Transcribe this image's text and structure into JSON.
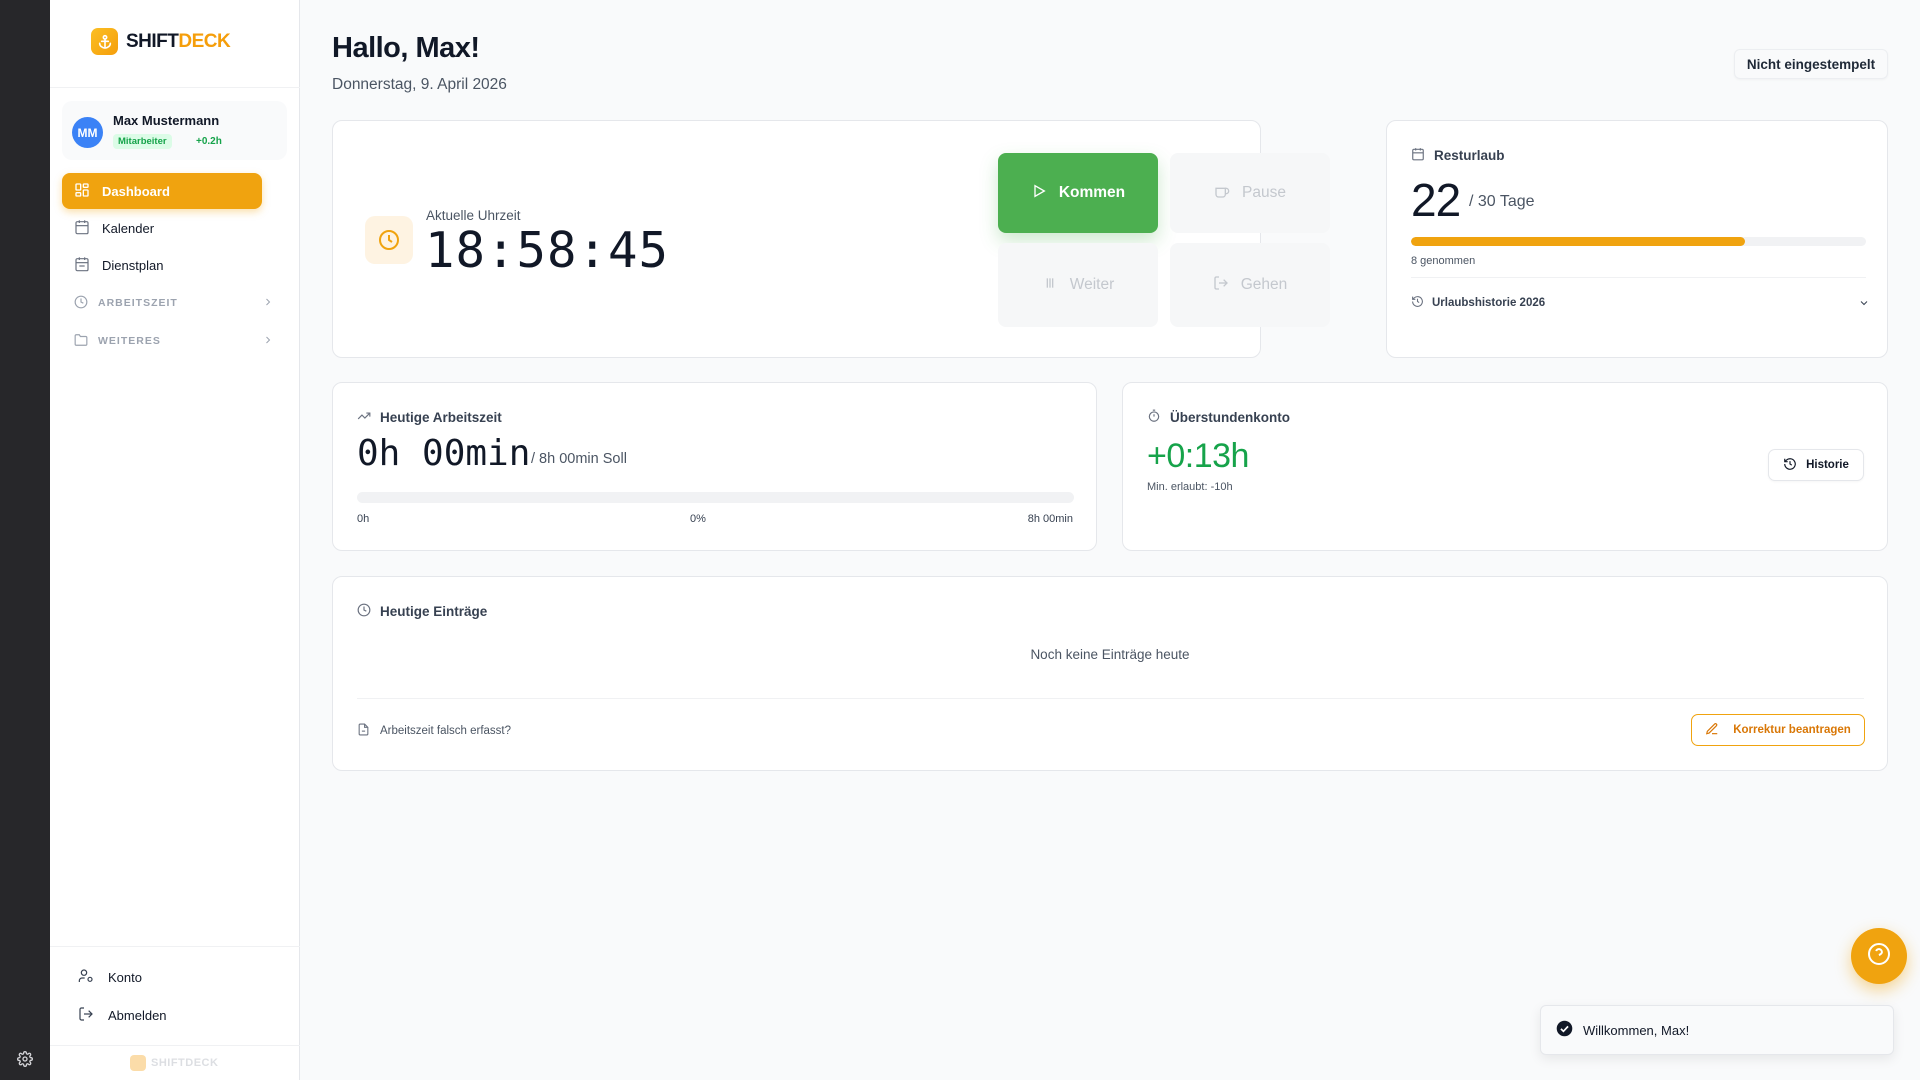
{
  "app": {
    "brand_part1": "SHIFT",
    "brand_part2": "DECK",
    "footer_brand": "SHIFTDECK",
    "accent_color": "#f0a30f",
    "success_color": "#4caf50"
  },
  "user": {
    "initials": "MM",
    "name": "Max Mustermann",
    "role": "Mitarbeiter",
    "balance": "+0.2h"
  },
  "nav": {
    "items": [
      {
        "label": "Dashboard",
        "icon": "dashboard-icon",
        "active": true
      },
      {
        "label": "Kalender",
        "icon": "calendar-icon",
        "active": false
      },
      {
        "label": "Dienstplan",
        "icon": "calendar-icon",
        "active": false
      }
    ],
    "groups": [
      {
        "label": "ARBEITSZEIT",
        "icon": "clock-icon"
      },
      {
        "label": "WEITERES",
        "icon": "folder-icon"
      }
    ],
    "account_label": "Konto",
    "logout_label": "Abmelden"
  },
  "header": {
    "greeting": "Hallo, Max!",
    "date": "Donnerstag, 9. April 2026",
    "status": "Nicht eingestempelt"
  },
  "clock": {
    "label": "Aktuelle Uhrzeit",
    "time": "18:58:45"
  },
  "actions": {
    "kommen": "Kommen",
    "pause": "Pause",
    "weiter": "Weiter",
    "gehen": "Gehen"
  },
  "vacation": {
    "title": "Resturlaub",
    "remaining": "22",
    "total": "/ 30 Tage",
    "used_fraction": 0.7333,
    "taken": "8 genommen",
    "history": "Urlaubshistorie 2026"
  },
  "worktime": {
    "title": "Heutige Arbeitszeit",
    "value": "0h 00min",
    "target": "/ 8h 00min Soll",
    "progress_fraction": 0,
    "scale_start": "0h",
    "scale_mid": "0%",
    "scale_end": "8h 00min"
  },
  "overtime": {
    "title": "Überstundenkonto",
    "value": "+0:13h",
    "min_allowed": "Min. erlaubt: -10h",
    "history_button": "Historie"
  },
  "entries": {
    "title": "Heutige Einträge",
    "empty": "Noch keine Einträge heute",
    "hint": "Arbeitszeit falsch erfasst?",
    "correction_button": "Korrektur beantragen"
  },
  "toast": {
    "message": "Willkommen, Max!"
  }
}
